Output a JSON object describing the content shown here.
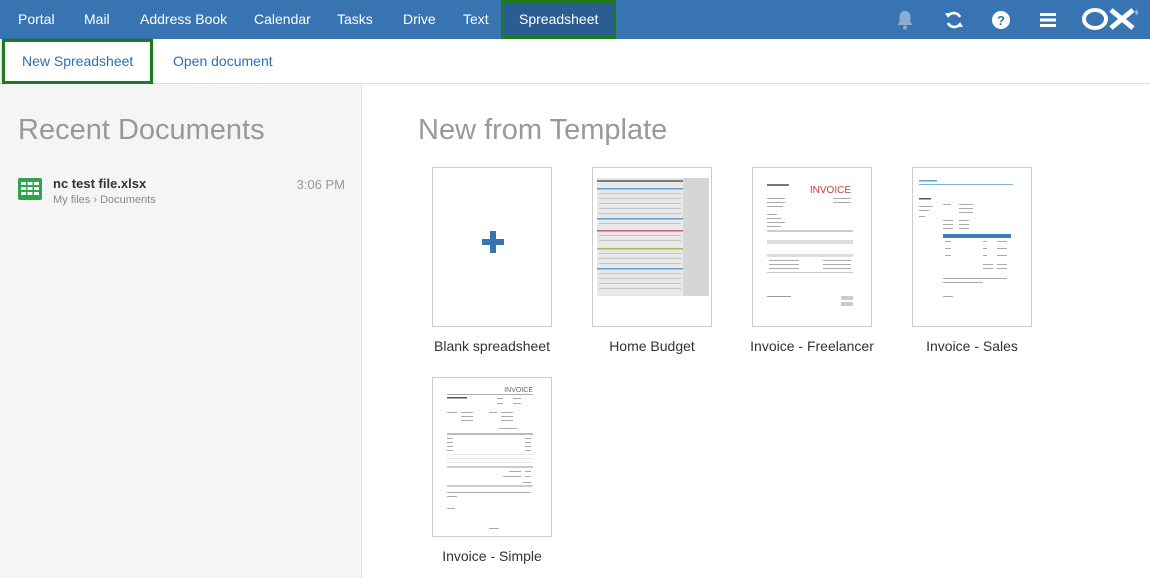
{
  "topnav": {
    "items": [
      "Portal",
      "Mail",
      "Address Book",
      "Calendar",
      "Tasks",
      "Drive",
      "Text"
    ],
    "active": "Spreadsheet",
    "logo": "OX"
  },
  "toolbar": {
    "new_spreadsheet": "New Spreadsheet",
    "open_document": "Open document"
  },
  "recent": {
    "title": "Recent Documents",
    "items": [
      {
        "name": "nc test file.xlsx",
        "path_root": "My files",
        "path_folder": "Documents",
        "time": "3:06 PM"
      }
    ]
  },
  "templates": {
    "title": "New from Template",
    "items": [
      {
        "label": "Blank spreadsheet"
      },
      {
        "label": "Home Budget"
      },
      {
        "label": "Invoice - Freelancer"
      },
      {
        "label": "Invoice - Sales"
      },
      {
        "label": "Invoice - Simple"
      }
    ]
  },
  "colors": {
    "topbar": "#3774b1",
    "highlight_border": "#1f7a1f",
    "link": "#2d6fb0",
    "spreadsheet_icon": "#2ea44f"
  }
}
